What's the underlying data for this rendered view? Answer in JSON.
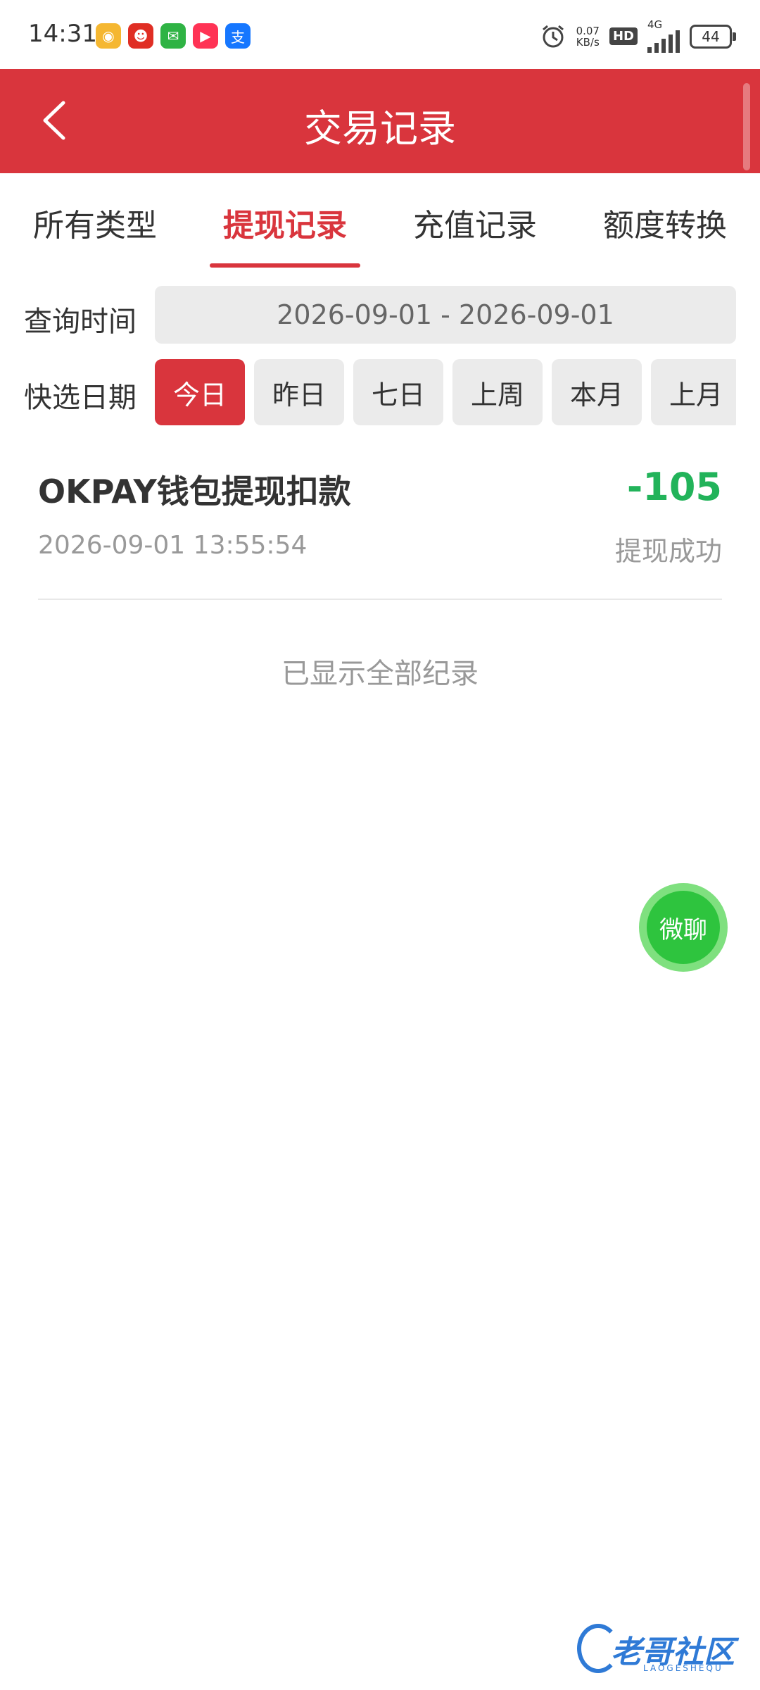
{
  "status_bar": {
    "time": "14:31",
    "app_icons": [
      {
        "name": "weibo-icon",
        "color": "#f5b731",
        "glyph": "◉"
      },
      {
        "name": "pinduoduo-icon",
        "color": "#e02e24",
        "glyph": "☻"
      },
      {
        "name": "wechat-icon",
        "color": "#2fb344",
        "glyph": "✉"
      },
      {
        "name": "video-app-icon",
        "color": "#ff3355",
        "glyph": "▶"
      },
      {
        "name": "alipay-icon",
        "color": "#1677ff",
        "glyph": "支"
      }
    ],
    "net_speed_value": "0.07",
    "net_speed_unit": "KB/s",
    "hd_label": "HD",
    "network": "4G",
    "battery": "44"
  },
  "header": {
    "title": "交易记录",
    "bg_color": "#d9353d"
  },
  "tabs": [
    {
      "label": "所有类型",
      "active": false
    },
    {
      "label": "提现记录",
      "active": true
    },
    {
      "label": "充值记录",
      "active": false
    },
    {
      "label": "额度转换",
      "active": false
    }
  ],
  "query": {
    "time_label": "查询时间",
    "date_range": "2026-09-01 - 2026-09-01",
    "quick_label": "快选日期",
    "quick_options": [
      {
        "label": "今日",
        "active": true
      },
      {
        "label": "昨日",
        "active": false
      },
      {
        "label": "七日",
        "active": false
      },
      {
        "label": "上周",
        "active": false
      },
      {
        "label": "本月",
        "active": false
      },
      {
        "label": "上月",
        "active": false
      }
    ]
  },
  "records": [
    {
      "title": "OKPAY钱包提现扣款",
      "amount": "-105",
      "time": "2026-09-01 13:55:54",
      "status": "提现成功"
    }
  ],
  "end_note": "已显示全部纪录",
  "chat_button": {
    "label": "微聊"
  },
  "watermark": {
    "text": "老哥社区",
    "sub": "LAOGESHEQU"
  }
}
